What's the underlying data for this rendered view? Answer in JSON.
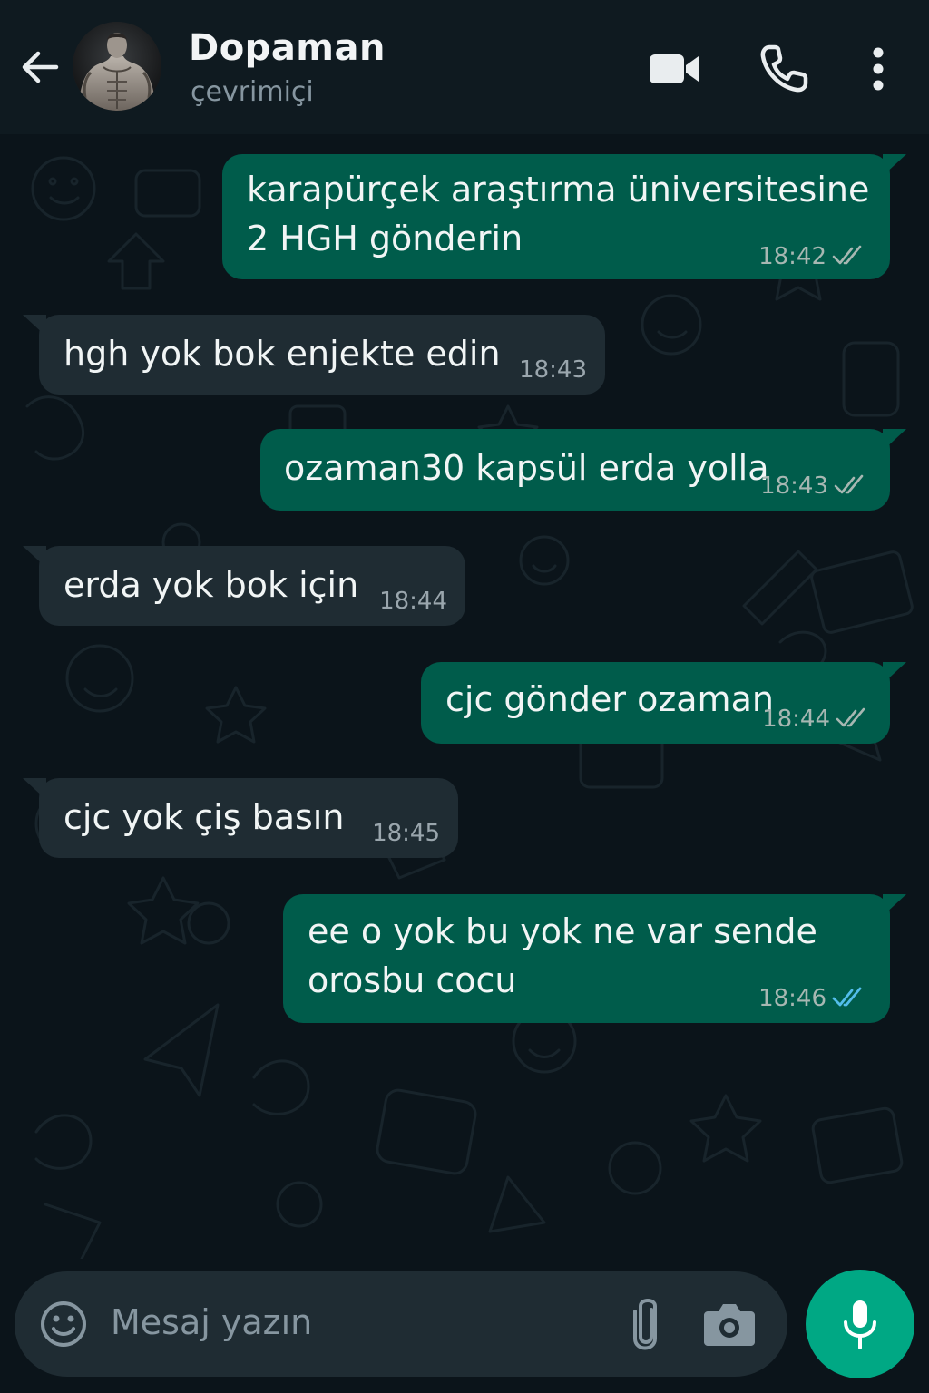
{
  "header": {
    "back_icon": "arrow-left-icon",
    "contact_name": "Dopaman",
    "status": "çevrimiçi",
    "actions": [
      "video-call-icon",
      "phone-icon",
      "more-vertical-icon"
    ]
  },
  "messages": [
    {
      "direction": "out",
      "lines": [
        "karapürçek araştırma üniversitesine",
        "2 HGH gönderin"
      ],
      "time": "18:42",
      "status": "read-ticks"
    },
    {
      "direction": "in",
      "lines": [
        "hgh yok bok enjekte edin"
      ],
      "time": "18:43"
    },
    {
      "direction": "out",
      "lines": [
        "ozaman30 kapsül erda yolla"
      ],
      "time": "18:43",
      "status": "read-ticks"
    },
    {
      "direction": "in",
      "lines": [
        "erda yok bok için"
      ],
      "time": "18:44"
    },
    {
      "direction": "out",
      "lines": [
        "cjc gönder ozaman"
      ],
      "time": "18:44",
      "status": "read-ticks"
    },
    {
      "direction": "in",
      "lines": [
        "cjc yok çiş basın"
      ],
      "time": "18:45"
    },
    {
      "direction": "out",
      "lines": [
        "ee o yok bu yok ne var sende",
        "orosbu cocu"
      ],
      "time": "18:46",
      "status": "read-ticks-blue"
    }
  ],
  "composer": {
    "placeholder": "Mesaj yazın",
    "icons": [
      "emoji-icon",
      "attach-icon",
      "camera-icon",
      "mic-icon"
    ]
  },
  "colors": {
    "background": "#0b141a",
    "header": "#0f1a20",
    "incoming_bubble": "#1f2c33",
    "outgoing_bubble": "#005c4b",
    "accent": "#00a884",
    "read_tick_blue": "#53bdeb"
  }
}
